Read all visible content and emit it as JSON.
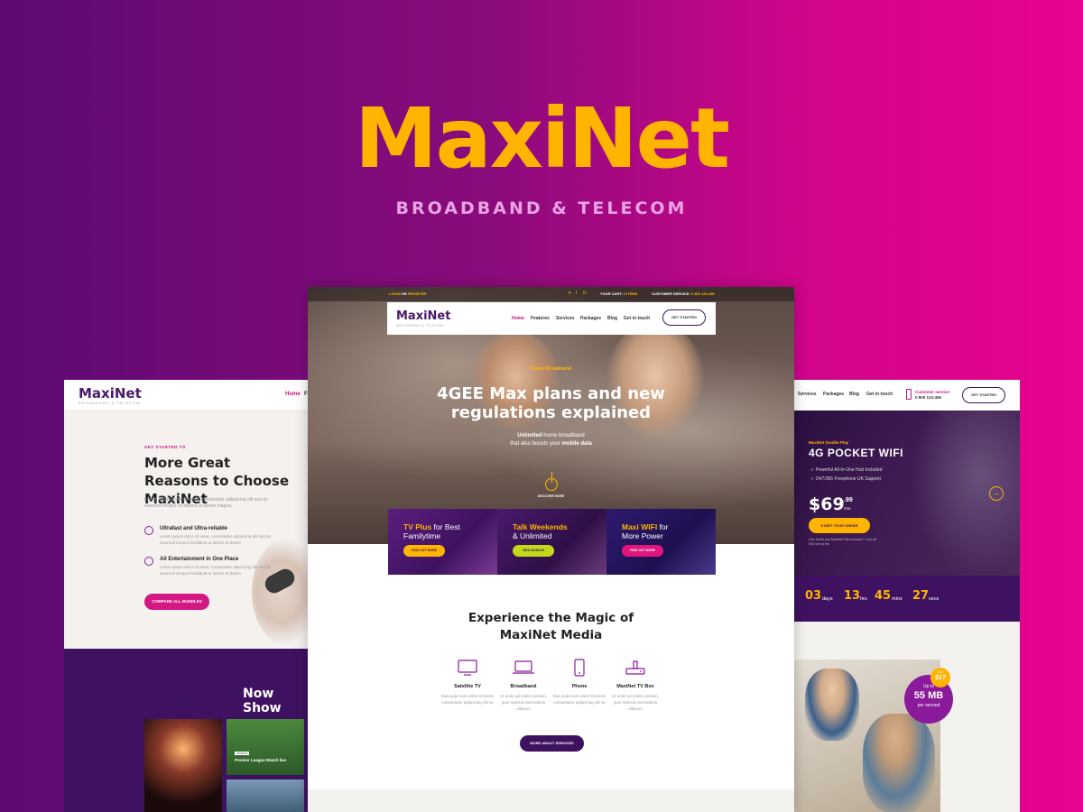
{
  "hero": {
    "title": "MaxiNet",
    "subtitle": "BROADBAND & TELECOM"
  },
  "colors": {
    "accent_yellow": "#ffb400",
    "brand_purple": "#3e1260",
    "brand_pink": "#c8117e",
    "background_gradient": [
      "#5d0a73",
      "#e8048e"
    ]
  },
  "left_mockup": {
    "logo": "MaxiNet",
    "logo_sub": "BROADBAND & TELECOM",
    "nav": [
      "Home",
      "Fe"
    ],
    "kicker": "GET STARTED TO",
    "heading": "More Great Reasons to Choose MaxiNet",
    "intro": "Lorem ipsum dolor sit amet, consectetur adipiscing elit sed do eiusmod tempor incididunt ut labore magna.",
    "features": [
      {
        "icon": "clock-icon",
        "title": "Ultrafast and Ultra-reliable",
        "text": "Lorem ipsum dolor sit amet, consectetur adipiscing elit sed do eiusmod tempor incididunt ut labore et dolore"
      },
      {
        "icon": "headset-icon",
        "title": "All Entertainment in One Place",
        "text": "Lorem ipsum dolor sit amet, consectetur adipiscing elit sed do eiusmod tempor incididunt ut labore et dolore"
      }
    ],
    "cta": "COMPARE ALL BUNDLES",
    "now_showing": "Now Show",
    "tile_badge": "SPORTS",
    "tile_label": "Premier League Watch live"
  },
  "center_mockup": {
    "topbar": {
      "login": "LOGIN",
      "or": " OR ",
      "register": "REGISTER",
      "cart_label": "YOUR CART: ",
      "cart_value": "2 ITEMS",
      "service_label": "CUSTOMER SERVICE: ",
      "service_value": "0 800 123-456",
      "social": [
        "twitter-icon",
        "facebook-icon",
        "linkedin-icon"
      ]
    },
    "logo": "MaxiNet",
    "logo_sub": "BROADBAND & TELECOM",
    "nav": [
      "Home",
      "Features",
      "Services",
      "Packages",
      "Blog",
      "Get in touch"
    ],
    "nav_button": "GET STARTED",
    "kicker": "Home Broadband",
    "headline_1": "4GEE Max plans and new",
    "headline_2": "regulations explained",
    "sub_1_bold": "Unlimited",
    "sub_1": " home broadband",
    "sub_2": "that also boosts your ",
    "sub_2_bold": "mobile data",
    "discover": "DISCOVER MORE",
    "promos": [
      {
        "bold": "TV Plus",
        "rest": " for Best",
        "line2": "Familytime",
        "button": "FIND OUT MORE",
        "bg": "#5b1d7e",
        "btn_bg": "#ffb400"
      },
      {
        "bold": "Talk Weekends",
        "rest": "",
        "line2": "& Unlimited",
        "button": "VIEW BUNDLE",
        "bg": "#4a1a6c",
        "btn_bg": "#c4d81a"
      },
      {
        "bold": "Maxi WIFI",
        "rest": " for",
        "line2": "More Power",
        "button": "FIND OUT MORE",
        "bg": "#2f1a70",
        "btn_bg": "#e0157e"
      }
    ],
    "section_title_1": "Experience the Magic of",
    "section_title_2": "MaxiNet Media",
    "services": [
      {
        "icon": "tv-icon",
        "title": "Satellite TV",
        "text": "Duis aute irure dolor sit amet, consectetur adipiscing elit se"
      },
      {
        "icon": "laptop-icon",
        "title": "Broadband",
        "text": "Ut enim ad minim veniam, quis nostrud exercitation ullamco"
      },
      {
        "icon": "phone-icon",
        "title": "Phone",
        "text": "Duis aute irure dolor sit amet, consectetur adipiscing elit se"
      },
      {
        "icon": "tv-box-icon",
        "title": "MaxiNet TV Box",
        "text": "Ut enim ad minim veniam, quis nostrud exercitation ullamco"
      }
    ],
    "more_button": "MORE ABOUT SERVICES"
  },
  "right_mockup": {
    "nav": [
      "Services",
      "Packages",
      "Blog",
      "Get in touch"
    ],
    "customer_service_label": "Customer service:",
    "customer_service_number": "0 800 123-456",
    "nav_button": "GET STARTED",
    "kicker": "MaxiNet Double Play",
    "title": "4G POCKET WIFI",
    "bullets": [
      "Powerful All-In-One Hub Included",
      "24/7/365 Freephone UK Support"
    ],
    "price": "$69",
    "price_cents": ".99",
    "price_per": "/mo",
    "order_button": "START YOUR ORDER",
    "fine_print": "Line rental and MaxiNet Talk included + one-off £30 set up fee",
    "arrow": "→",
    "countdown": [
      {
        "value": "03",
        "unit": "days"
      },
      {
        "value": "13",
        "unit": "hrs"
      },
      {
        "value": "45",
        "unit": "mins"
      },
      {
        "value": "27",
        "unit": "secs"
      }
    ],
    "badge_up": "Up to",
    "badge_speed": "55 MB",
    "badge_per": "per second",
    "small_badge_top": "Just",
    "small_badge_value": "$17"
  }
}
